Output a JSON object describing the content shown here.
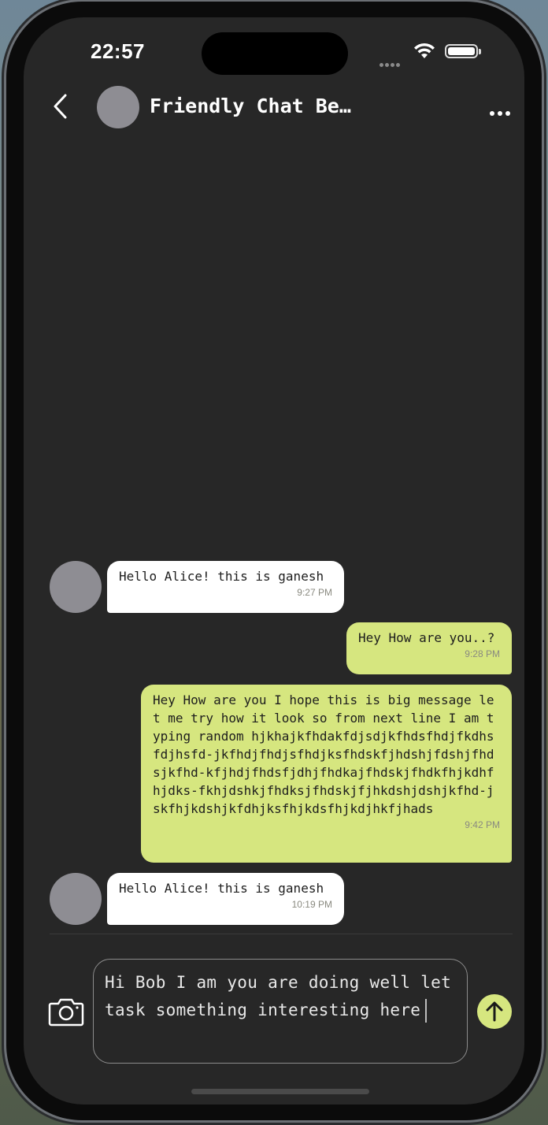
{
  "status_bar": {
    "time": "22:57"
  },
  "header": {
    "title": "Friendly Chat Between Alic…",
    "back_icon": "chevron-left-icon",
    "more_icon": "ellipsis-icon"
  },
  "messages": [
    {
      "direction": "incoming",
      "text": "Hello Alice! this is ganesh",
      "time": "9:27 PM"
    },
    {
      "direction": "outgoing",
      "text": "Hey How are you..?",
      "time": "9:28 PM"
    },
    {
      "direction": "outgoing",
      "text": "Hey How are you I hope this is big message let me try how it look so from next line I am typing random hjkhajkfhdakfdjsdjkfhdsfhdjfkdhsfdjhsfd-jkfhdjfhdjsfhdjksfhdskfjhdshjfdshjfhdsjkfhd-kfjhdjfhdsfjdhjfhdkajfhdskjfhdkfhjkdhfhjdks-fkhjdshkjfhdksjfhdskjfjhkdshjdshjkfhd-jskfhjkdshjkfdhjksfhjkdsfhjkdjhkfjhads",
      "time": "9:42 PM"
    },
    {
      "direction": "incoming",
      "text": "Hello Alice! this is ganesh",
      "time": "10:19 PM"
    }
  ],
  "composer": {
    "value": "Hi Bob I am you are doing well let task something interesting here",
    "camera_icon": "camera-icon",
    "send_icon": "arrow-up-icon"
  },
  "colors": {
    "background": "#272727",
    "incoming_bubble": "#ffffff",
    "outgoing_bubble": "#d6e67f",
    "avatar": "#8e8d93"
  }
}
